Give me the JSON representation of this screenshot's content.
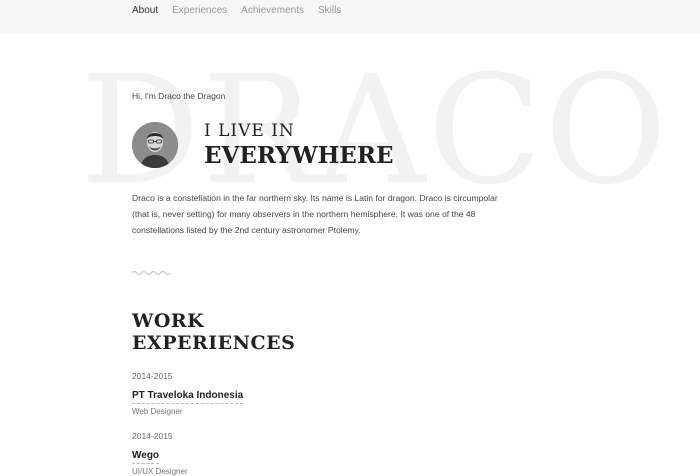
{
  "nav": {
    "items": [
      {
        "label": "About",
        "active": true
      },
      {
        "label": "Experiences",
        "active": false
      },
      {
        "label": "Achievements",
        "active": false
      },
      {
        "label": "Skills",
        "active": false
      }
    ]
  },
  "hero": {
    "background_word": "DRACO",
    "greeting": "Hi, I'm Draco the Dragon",
    "title_line1": "I LIVE IN",
    "title_line2": "EVERYWHERE",
    "intro": "Draco is a constellation in the far northern sky. Its name is Latin for dragon. Draco is circumpolar (that is, never setting) for many observers in the northern hemisphere. It was one of the 48 constellations listed by the 2nd century astronomer Ptolemy."
  },
  "work": {
    "title_line1": "WORK",
    "title_line2": "EXPERIENCES",
    "items": [
      {
        "period": "2014-2015",
        "company": "PT Traveloka Indonesia",
        "role": "Web Designer"
      },
      {
        "period": "2014-2015",
        "company": "Wego",
        "role": "UI/UX Designer"
      }
    ]
  },
  "colors": {
    "topbar": "#f7f7f7",
    "background_word": "#f2f2f2",
    "text": "#222222",
    "muted": "#9a9a9a"
  }
}
